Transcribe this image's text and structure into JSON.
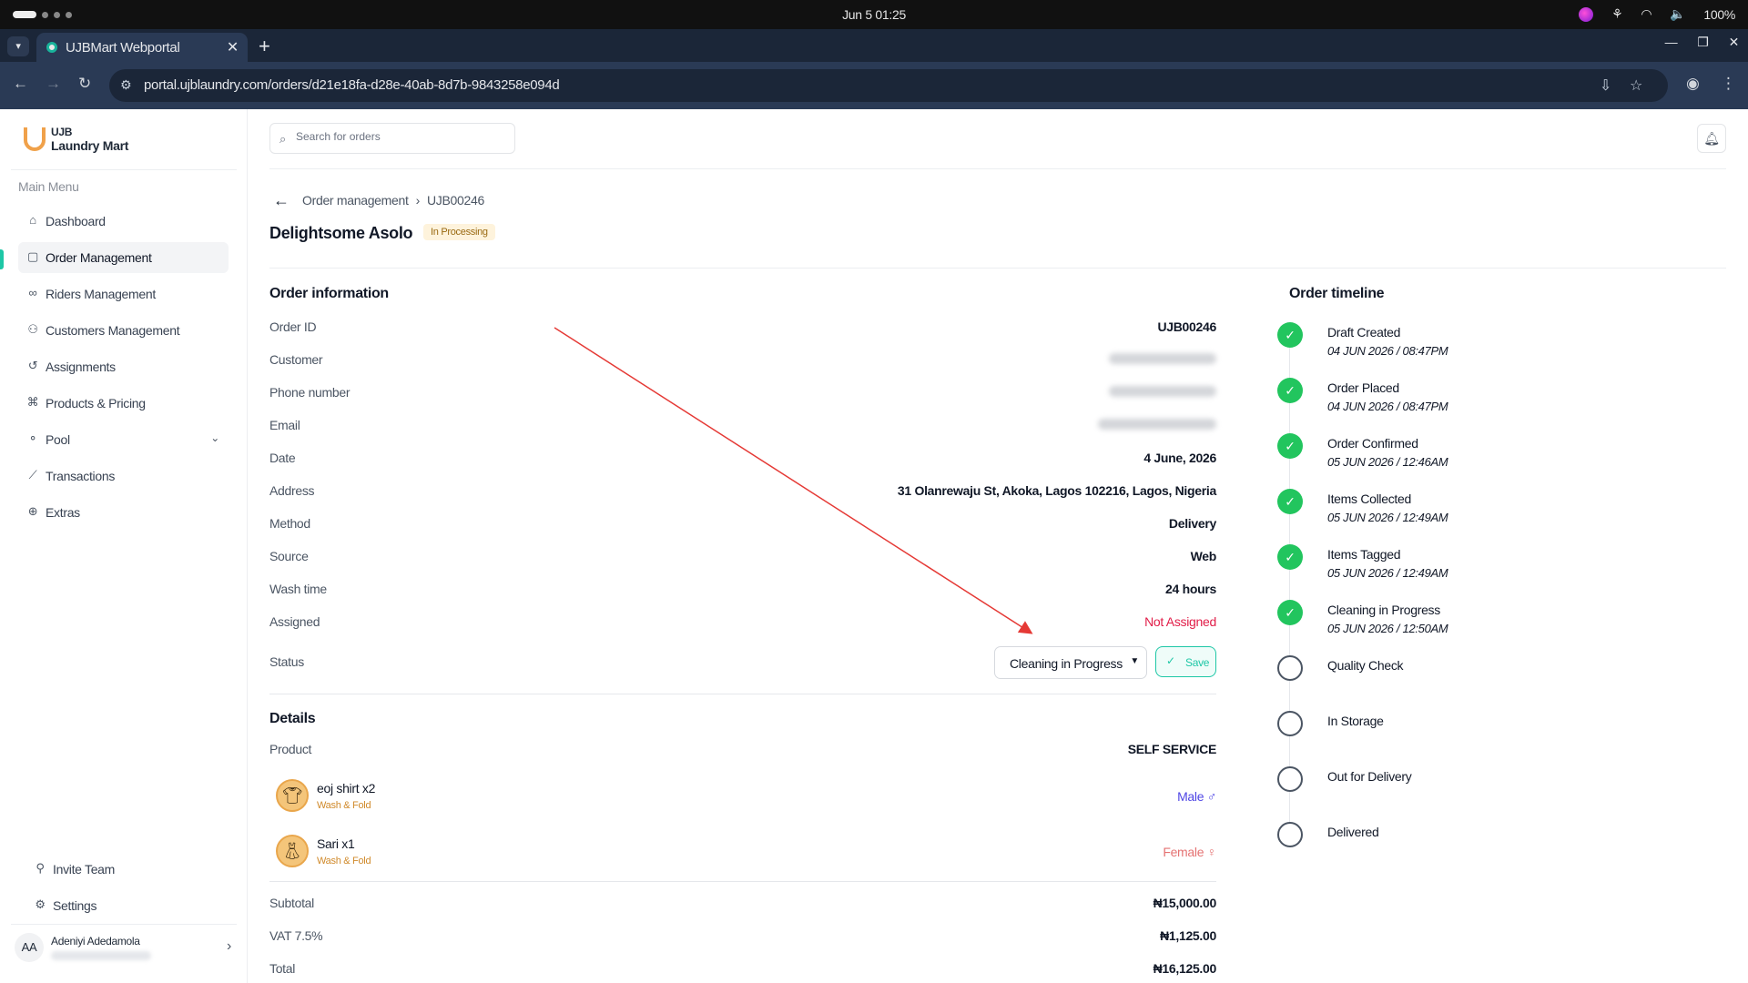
{
  "os": {
    "clock": "Jun 5  01:25",
    "battery": "100%"
  },
  "browser": {
    "tab_title": "UJBMart Webportal",
    "url": "portal.ujblaundry.com/orders/d21e18fa-d28e-40ab-8d7b-9843258e094d"
  },
  "sidebar": {
    "logo_line1": "UJB",
    "logo_line2": "Laundry Mart",
    "menu_title": "Main Menu",
    "items": [
      {
        "label": "Dashboard",
        "icon": "home-icon"
      },
      {
        "label": "Order Management",
        "icon": "bag-icon",
        "active": true
      },
      {
        "label": "Riders Management",
        "icon": "bike-icon"
      },
      {
        "label": "Customers Management",
        "icon": "users-icon"
      },
      {
        "label": "Assignments",
        "icon": "history-icon"
      },
      {
        "label": "Products & Pricing",
        "icon": "tag-icon"
      },
      {
        "label": "Pool",
        "icon": "pool-icon"
      },
      {
        "label": "Transactions",
        "icon": "chart-icon"
      },
      {
        "label": "Extras",
        "icon": "globe-icon"
      }
    ],
    "invite": "Invite Team",
    "settings": "Settings",
    "user": {
      "initials": "AA",
      "name": "Adeniyi Adedamola"
    }
  },
  "header": {
    "search_placeholder": "Search for orders"
  },
  "breadcrumb": {
    "parent": "Order management",
    "current": "UJB00246"
  },
  "page": {
    "title": "Delightsome Asolo",
    "badge": "In Processing"
  },
  "order_info": {
    "title": "Order information",
    "rows": [
      {
        "label": "Order ID",
        "value": "UJB00246"
      },
      {
        "label": "Customer",
        "value": ""
      },
      {
        "label": "Phone number",
        "value": ""
      },
      {
        "label": "Email",
        "value": ""
      },
      {
        "label": "Date",
        "value": "4 June, 2026"
      },
      {
        "label": "Address",
        "value": "31 Olanrewaju St, Akoka, Lagos 102216, Lagos, Nigeria"
      },
      {
        "label": "Method",
        "value": "Delivery"
      },
      {
        "label": "Source",
        "value": "Web"
      },
      {
        "label": "Wash time",
        "value": "24 hours"
      },
      {
        "label": "Assigned",
        "value": "Not Assigned"
      }
    ],
    "status_label": "Status",
    "status_value": "Cleaning in Progress",
    "save_label": "Save"
  },
  "details": {
    "title": "Details",
    "product_label": "Product",
    "product_value": "SELF SERVICE",
    "items": [
      {
        "name": "eoj shirt  x2",
        "service": "Wash & Fold",
        "gender": "Male ♂"
      },
      {
        "name": "Sari  x1",
        "service": "Wash & Fold",
        "gender": "Female ♀"
      }
    ],
    "subtotal_label": "Subtotal",
    "subtotal": "₦15,000.00",
    "vat_label": "VAT 7.5%",
    "vat": "₦1,125.00",
    "total_label": "Total",
    "total": "₦16,125.00"
  },
  "timeline": {
    "title": "Order timeline",
    "steps": [
      {
        "label": "Draft Created",
        "date": "04 JUN 2026 / 08:47PM",
        "done": true
      },
      {
        "label": "Order Placed",
        "date": "04 JUN 2026 / 08:47PM",
        "done": true
      },
      {
        "label": "Order Confirmed",
        "date": "05 JUN 2026 / 12:46AM",
        "done": true
      },
      {
        "label": "Items Collected",
        "date": "05 JUN 2026 / 12:49AM",
        "done": true
      },
      {
        "label": "Items Tagged",
        "date": "05 JUN 2026 / 12:49AM",
        "done": true
      },
      {
        "label": "Cleaning in Progress",
        "date": "05 JUN 2026 / 12:50AM",
        "done": true
      },
      {
        "label": "Quality Check",
        "date": "",
        "done": false
      },
      {
        "label": "In Storage",
        "date": "",
        "done": false
      },
      {
        "label": "Out for Delivery",
        "date": "",
        "done": false
      },
      {
        "label": "Delivered",
        "date": "",
        "done": false
      }
    ]
  },
  "colors": {
    "accent": "#1ec7a6",
    "done": "#22c55e",
    "danger": "#e11d48",
    "annotation_arrow": "#e53935"
  }
}
